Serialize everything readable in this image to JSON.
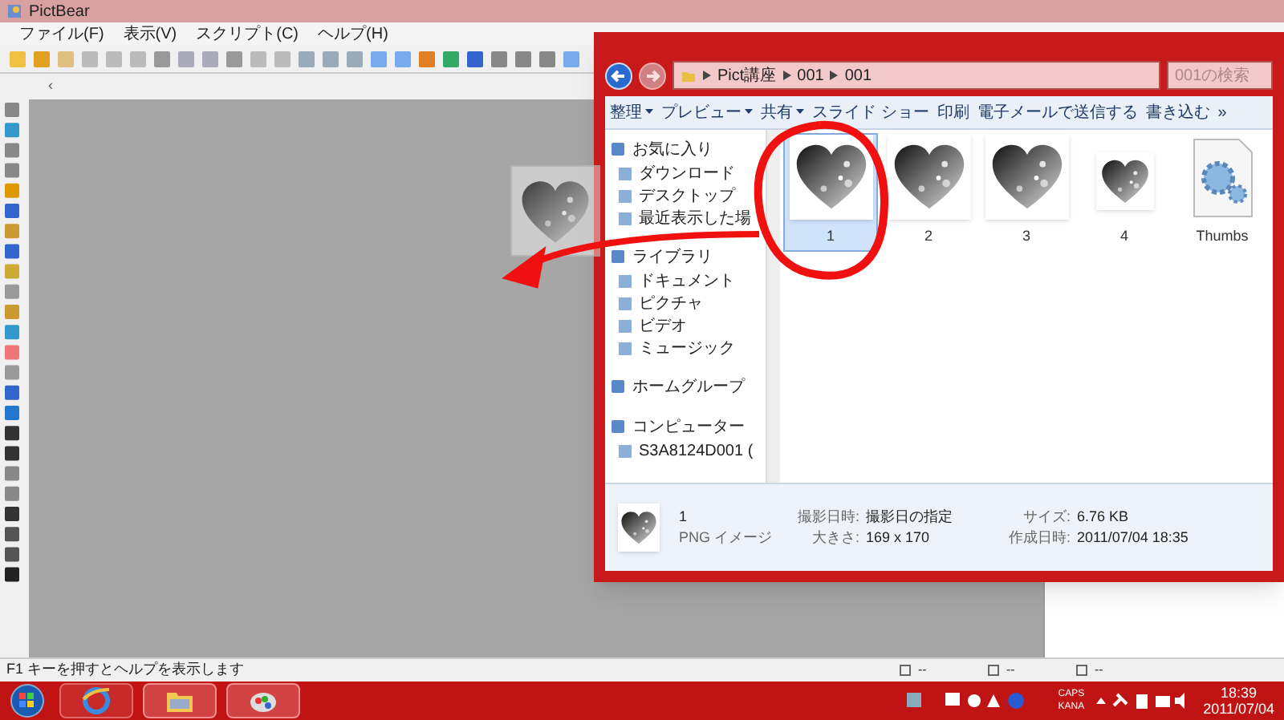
{
  "app": {
    "title": "PictBear",
    "menu": [
      "ファイル(F)",
      "表示(V)",
      "スクリプト(C)",
      "ヘルプ(H)"
    ],
    "ruler_mark": "‹",
    "status": "F1 キーを押すとヘルプを表示します",
    "status_fields": [
      "--",
      "--",
      "--"
    ]
  },
  "explorer": {
    "breadcrumb": [
      "Pict講座",
      "001",
      "001"
    ],
    "search": {
      "placeholder": "001の検索"
    },
    "commands": [
      {
        "label": "整理",
        "dropdown": true
      },
      {
        "label": "プレビュー",
        "dropdown": true
      },
      {
        "label": "共有",
        "dropdown": true
      },
      {
        "label": "スライド ショー",
        "dropdown": false
      },
      {
        "label": "印刷",
        "dropdown": false
      },
      {
        "label": "電子メールで送信する",
        "dropdown": false
      },
      {
        "label": "書き込む",
        "dropdown": false
      },
      {
        "label": "»",
        "dropdown": false
      }
    ],
    "nav": [
      {
        "label": "お気に入り",
        "children": [
          {
            "label": "ダウンロード"
          },
          {
            "label": "デスクトップ"
          },
          {
            "label": "最近表示した場"
          }
        ]
      },
      {
        "label": "ライブラリ",
        "children": [
          {
            "label": "ドキュメント"
          },
          {
            "label": "ピクチャ"
          },
          {
            "label": "ビデオ"
          },
          {
            "label": "ミュージック"
          }
        ]
      },
      {
        "label": "ホームグループ"
      },
      {
        "label": "コンピューター",
        "children": [
          {
            "label": "S3A8124D001 ("
          }
        ]
      }
    ],
    "files": [
      {
        "name": "1",
        "kind": "image",
        "selected": true
      },
      {
        "name": "2",
        "kind": "image",
        "selected": false
      },
      {
        "name": "3",
        "kind": "image",
        "selected": false
      },
      {
        "name": "4",
        "kind": "small-image",
        "selected": false
      },
      {
        "name": "Thumbs",
        "kind": "system",
        "selected": false
      }
    ],
    "details": {
      "name": "1",
      "type": "PNG イメージ",
      "fields": [
        {
          "label": "撮影日時:",
          "value": "撮影日の指定"
        },
        {
          "label": "大きさ:",
          "value": "169 x 170"
        },
        {
          "label": "サイズ:",
          "value": "6.76 KB"
        },
        {
          "label": "作成日時:",
          "value": "2011/07/04 18:35"
        }
      ]
    }
  },
  "taskbar": {
    "indicators": [
      "CAPS",
      "KANA"
    ],
    "time": "18:39",
    "date": "2011/07/04"
  }
}
